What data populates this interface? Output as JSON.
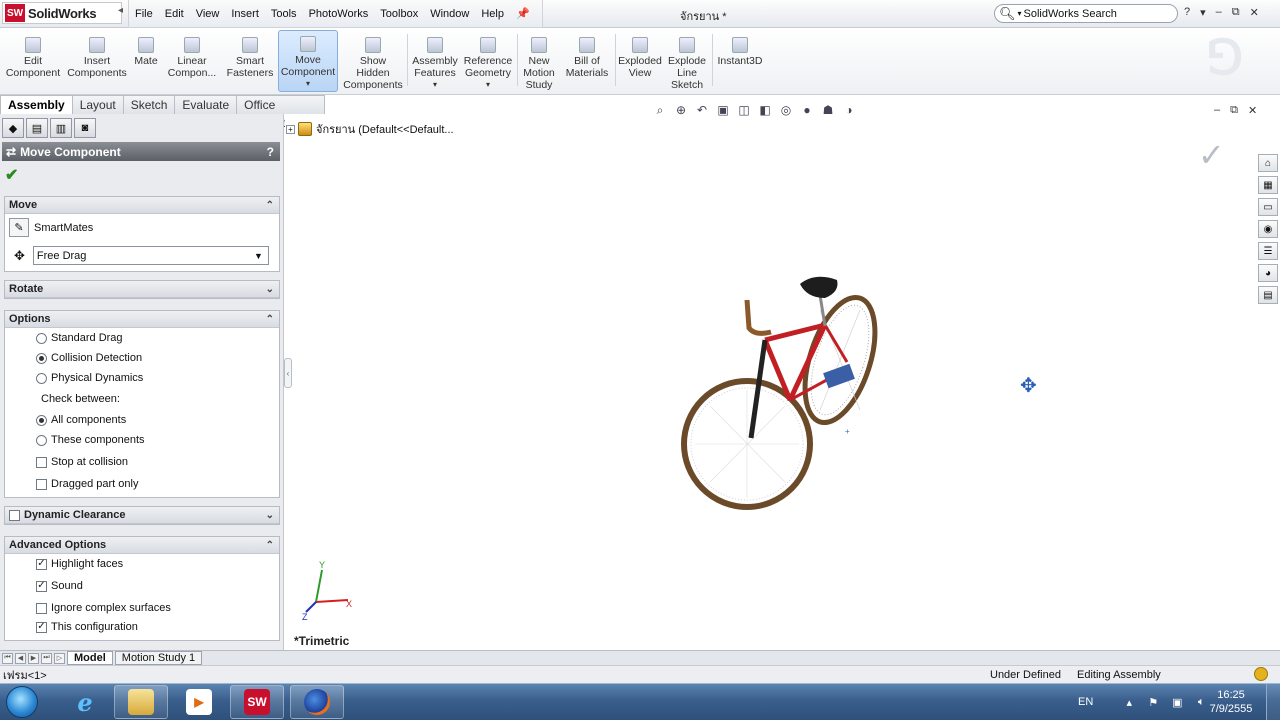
{
  "app": {
    "name": "SolidWorks",
    "logo_text": "SW",
    "document_title": "จักรยาน *"
  },
  "menu": [
    "File",
    "Edit",
    "View",
    "Insert",
    "Tools",
    "PhotoWorks",
    "Toolbox",
    "Window",
    "Help"
  ],
  "search": {
    "placeholder": "SolidWorks Search"
  },
  "title_buttons": {
    "help": "?",
    "dropdown": "▾",
    "minimize": "–",
    "restore": "⧉",
    "close": "✕"
  },
  "commands": [
    {
      "line1": "Edit",
      "line2": "Component"
    },
    {
      "line1": "Insert",
      "line2": "Components"
    },
    {
      "line1": "Mate",
      "line2": ""
    },
    {
      "line1": "Linear",
      "line2": "Compon..."
    },
    {
      "line1": "Smart",
      "line2": "Fasteners"
    },
    {
      "line1": "Move",
      "line2": "Component"
    },
    {
      "line1": "Show",
      "line2": "Hidden",
      "line3": "Components"
    },
    {
      "line1": "Assembly",
      "line2": "Features"
    },
    {
      "line1": "Reference",
      "line2": "Geometry"
    },
    {
      "line1": "New",
      "line2": "Motion",
      "line3": "Study"
    },
    {
      "line1": "Bill of",
      "line2": "Materials"
    },
    {
      "line1": "Exploded",
      "line2": "View"
    },
    {
      "line1": "Explode",
      "line2": "Line",
      "line3": "Sketch"
    },
    {
      "line1": "Instant3D",
      "line2": ""
    }
  ],
  "tabs": [
    "Assembly",
    "Layout",
    "Sketch",
    "Evaluate",
    "Office Products"
  ],
  "property_manager": {
    "title": "Move Component",
    "help": "?",
    "move": {
      "header": "Move",
      "smartmates": "SmartMates",
      "mode_selected": "Free Drag"
    },
    "rotate": {
      "header": "Rotate"
    },
    "options": {
      "header": "Options",
      "drag_modes": [
        "Standard Drag",
        "Collision Detection",
        "Physical Dynamics"
      ],
      "selected_mode": "Collision Detection",
      "check_between_label": "Check between:",
      "check_between": [
        "All components",
        "These components"
      ],
      "checkbox_stop": "Stop at collision",
      "checkbox_dragged": "Dragged part only"
    },
    "dynamic_clearance": {
      "header": "Dynamic Clearance"
    },
    "advanced": {
      "header": "Advanced Options",
      "items": [
        {
          "label": "Highlight faces",
          "checked": true
        },
        {
          "label": "Sound",
          "checked": true
        },
        {
          "label": "Ignore complex surfaces",
          "checked": false
        },
        {
          "label": "This configuration",
          "checked": true
        }
      ]
    }
  },
  "tree": {
    "root": "จักรยาน  (Default<<Default..."
  },
  "viewport": {
    "view_name": "*Trimetric",
    "triad": {
      "x": "X",
      "y": "Y",
      "z": "Z"
    }
  },
  "bottom_tabs": [
    "Model",
    "Motion Study 1"
  ],
  "status": {
    "left": "เฟรม<1>",
    "state": "Under Defined",
    "mode": "Editing Assembly"
  },
  "taskbar": {
    "apps": [
      "Internet Explorer",
      "Windows Explorer",
      "Media Player",
      "SolidWorks",
      "Firefox"
    ],
    "language": "EN",
    "time": "16:25",
    "date": "7/9/2555"
  },
  "colors": {
    "accent": "#c8102e",
    "active_command": "#b9d5f5",
    "header_bg": "#5b5f66",
    "check_green": "#2a8a22"
  }
}
